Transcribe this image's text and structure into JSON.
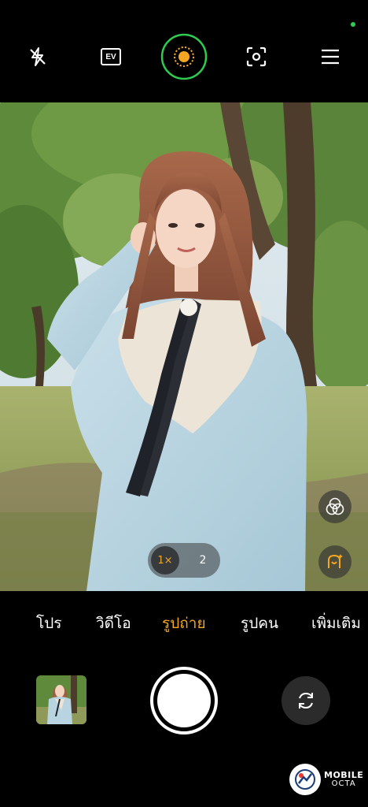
{
  "top_toolbar": {
    "flash_icon": "flash-off-icon",
    "ev_label": "EV",
    "pro_mode_icon": "ai-scene-icon",
    "focus_icon": "focus-frame-icon",
    "menu_icon": "hamburger-menu-icon",
    "accent_color": "#2ecc4f",
    "active_icon_color": "#f5a623"
  },
  "zoom": {
    "options": [
      "1×",
      "2"
    ],
    "selected": "1×"
  },
  "viewfinder_buttons": {
    "filter_icon": "filter-circles-icon",
    "beauty_icon": "beauty-portrait-icon"
  },
  "modes": {
    "items": [
      "โปร",
      "วิดีโอ",
      "รูปถ่าย",
      "รูปคน",
      "เพิ่มเติม"
    ],
    "selected": "รูปถ่าย",
    "active_color": "#f5a623"
  },
  "controls": {
    "gallery_icon": "gallery-thumbnail",
    "shutter_icon": "shutter-button",
    "flip_icon": "camera-flip-icon"
  },
  "watermark": {
    "line1": "MOBILE",
    "line2": "OCTA"
  }
}
